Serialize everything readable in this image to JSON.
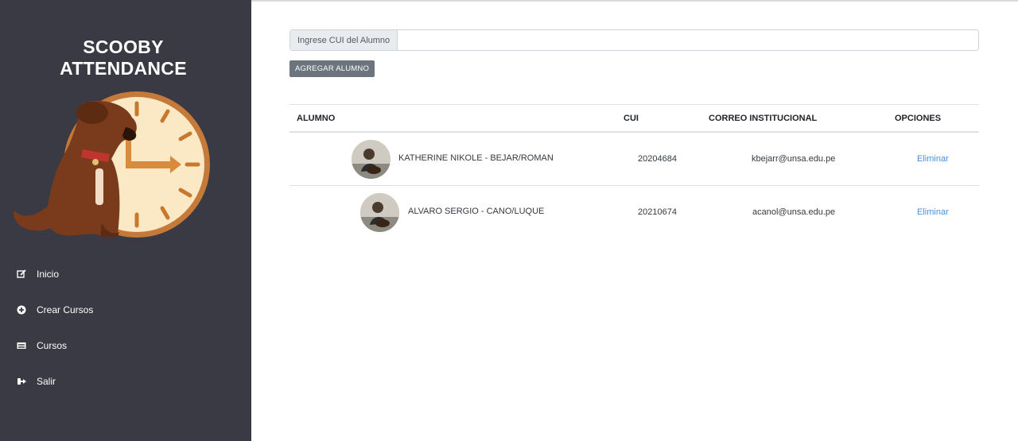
{
  "sidebar": {
    "brand_line1": "SCOOBY",
    "brand_line2": "ATTENDANCE",
    "logo_icon": "dog-clock-logo",
    "items": [
      {
        "label": "Inicio",
        "icon": "edit-icon"
      },
      {
        "label": "Crear Cursos",
        "icon": "plus-circle-icon"
      },
      {
        "label": "Cursos",
        "icon": "list-icon"
      },
      {
        "label": "Salir",
        "icon": "sign-out-icon"
      }
    ]
  },
  "search": {
    "label": "Ingrese CUI del Alumno",
    "value": "",
    "placeholder": ""
  },
  "actions": {
    "add_label": "AGREGAR ALUMNO"
  },
  "table": {
    "headers": {
      "alumno": "ALUMNO",
      "cui": "CUI",
      "correo": "CORREO INSTITUCIONAL",
      "opciones": "OPCIONES"
    },
    "rows": [
      {
        "name": "KATHERINE NIKOLE - BEJAR/ROMAN",
        "cui": "20204684",
        "email": "kbejarr@unsa.edu.pe",
        "option": "Eliminar"
      },
      {
        "name": "ALVARO SERGIO - CANO/LUQUE",
        "cui": "20210674",
        "email": "acanol@unsa.edu.pe",
        "option": "Eliminar"
      }
    ]
  },
  "colors": {
    "sidebar_bg": "#393a43",
    "button_bg": "#6c757d",
    "link": "#4a8fd9"
  }
}
